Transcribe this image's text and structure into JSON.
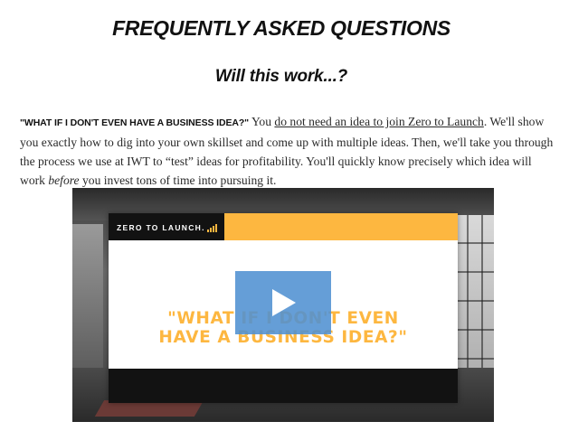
{
  "faq": {
    "title": "FREQUENTLY ASKED QUESTIONS",
    "subtitle": "Will this work...?",
    "question": "\"WHAT IF I DON'T EVEN HAVE A BUSINESS IDEA?\"",
    "answer_part1": " You ",
    "answer_link": "do not need an idea to join Zero to Launch",
    "answer_part2": ". We'll show you exactly how to dig into your own skillset and come up with multiple ideas. Then, we'll take you through the process we use at IWT to “test” ideas for profitability. You'll quickly know precisely which idea will work ",
    "answer_emphasis": "before",
    "answer_part3": " you invest tons of time into pursuing it."
  },
  "video": {
    "logo_text": "ZERO TO LAUNCH.",
    "question_line1": "\"WHAT IF I DON'T EVEN",
    "question_line2": "HAVE A BUSINESS IDEA?\"",
    "colors": {
      "accent": "#fdb740",
      "dark": "#121212",
      "play": "#5091d2"
    },
    "play_icon": "play-icon"
  }
}
